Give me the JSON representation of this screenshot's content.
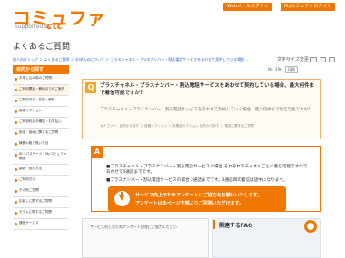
{
  "header": {
    "logo": "コミュファ",
    "logo_sub": "Supported by",
    "logo_brand": "ctc",
    "buttons": [
      "Webメールログイン",
      "Myコミュファログイン"
    ]
  },
  "page_title": "よくあるご質問",
  "breadcrumb": "個人向けトップ ＞ よくあるご質問 ＞ お申込みについて ＞ プラスチャネル・プラスナンバー・割込電話サービスをあわせて契約している場合...",
  "font_size": {
    "label": "文字サイズ変更",
    "options": [
      "小",
      "中",
      "大"
    ]
  },
  "sidebar": {
    "heading": "目的から探す",
    "items": [
      "お申し込み前のご質問",
      "ご利用開始・解約までのご案内",
      "ご契約内容・変更・解約",
      "各種オプション",
      "ご利用料金の確認・お支払い",
      "設定・接続に関するご質問",
      "機器の取り扱い方法",
      "ID・パスワード・Myコミュファ関連",
      "接続・設定方法",
      "ご利用方法",
      "その他ご質問",
      "引越しに関するご質問",
      "モデムに関するご質問",
      "通信サービス"
    ]
  },
  "meta": {
    "number": "No. 396",
    "print": "印刷"
  },
  "question": {
    "badge": "Q",
    "title": "プラスチャネル・プラスナンバー・割込電話サービスをあわせて契約している場合、最大何件まで着信可能ですか？",
    "body": "プラスチャネル・プラスナンバー・割込電話サービスをあわせて契約している場合、最大何件まで着信可能ですか？",
    "categories": "カテゴリー：目的から探す ＞ 各種オプション ＞ 光電話オプション  目的から探す ＞ 電話に関するご質問"
  },
  "answer": {
    "badge": "A",
    "text1": "■プラスチャネル・プラスナンバー・割込電話サービスの場合 それぞれのチャネルごとに着信可能ですので、あわせて4通話までです。",
    "text2": "■プラスナンバー・割込電話サービスの場合 2通話までです。3通話目の着信は話中になります。",
    "cta_line1": "サービス向上のためアンケートにご協力をお願いいたします。",
    "cta_line2": "アンケートは本ページ下部よりご回答いただけます。"
  },
  "survey": {
    "text": "サービス向上のためアンケート回答にご協力ください"
  },
  "related": {
    "title": "関連するFAQ"
  },
  "colors": {
    "brand": "#f07800",
    "question_bg": "#fffaf3",
    "related_bg": "#eef3f8"
  }
}
